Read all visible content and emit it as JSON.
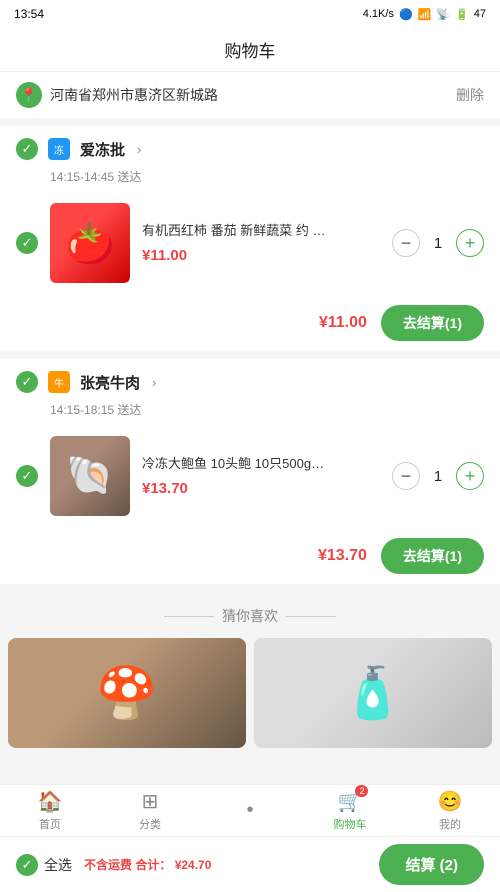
{
  "statusBar": {
    "time": "13:54",
    "network": "4.1K/s",
    "battery": "47"
  },
  "header": {
    "title": "购物车"
  },
  "location": {
    "text": "河南省郑州市惠济区新城路",
    "deleteLabel": "删除"
  },
  "stores": [
    {
      "id": "store1",
      "iconLabel": "冻",
      "name": "爱冻批",
      "delivery": "14:15-14:45 送达",
      "products": [
        {
          "name": "有机西红柿 番茄 新鲜蔬菜 约 …",
          "price": "¥11.00",
          "quantity": 1,
          "emoji": "🍅"
        }
      ],
      "total": "¥11.00",
      "checkoutLabel": "去结算(1)"
    },
    {
      "id": "store2",
      "iconLabel": "牛",
      "name": "张亮牛肉",
      "delivery": "14:15-18:15 送达",
      "products": [
        {
          "name": "冷冻大鲍鱼 10头鲍 10只500g…",
          "price": "¥13.70",
          "quantity": 1,
          "emoji": "🐚"
        }
      ],
      "total": "¥13.70",
      "checkoutLabel": "去结算(1)"
    }
  ],
  "recommendation": {
    "title": "猜你喜欢",
    "items": [
      {
        "emoji": "🍄",
        "label": "item1"
      },
      {
        "emoji": "🧴",
        "label": "item2"
      }
    ]
  },
  "bottomBar": {
    "selectAllLabel": "全选",
    "shippingNote": "不含运费 合计：",
    "total": "¥24.70",
    "checkoutLabel": "结算 (2)"
  },
  "navBar": {
    "items": [
      {
        "key": "home",
        "icon": "🏠",
        "label": "首页",
        "active": false
      },
      {
        "key": "category",
        "icon": "⊞",
        "label": "分类",
        "active": false
      },
      {
        "key": "dot",
        "icon": "•",
        "label": "",
        "active": false
      },
      {
        "key": "cart",
        "icon": "🛒",
        "label": "购物车",
        "active": true,
        "badge": "2"
      },
      {
        "key": "mine",
        "icon": "😊",
        "label": "我的",
        "active": false
      }
    ]
  }
}
